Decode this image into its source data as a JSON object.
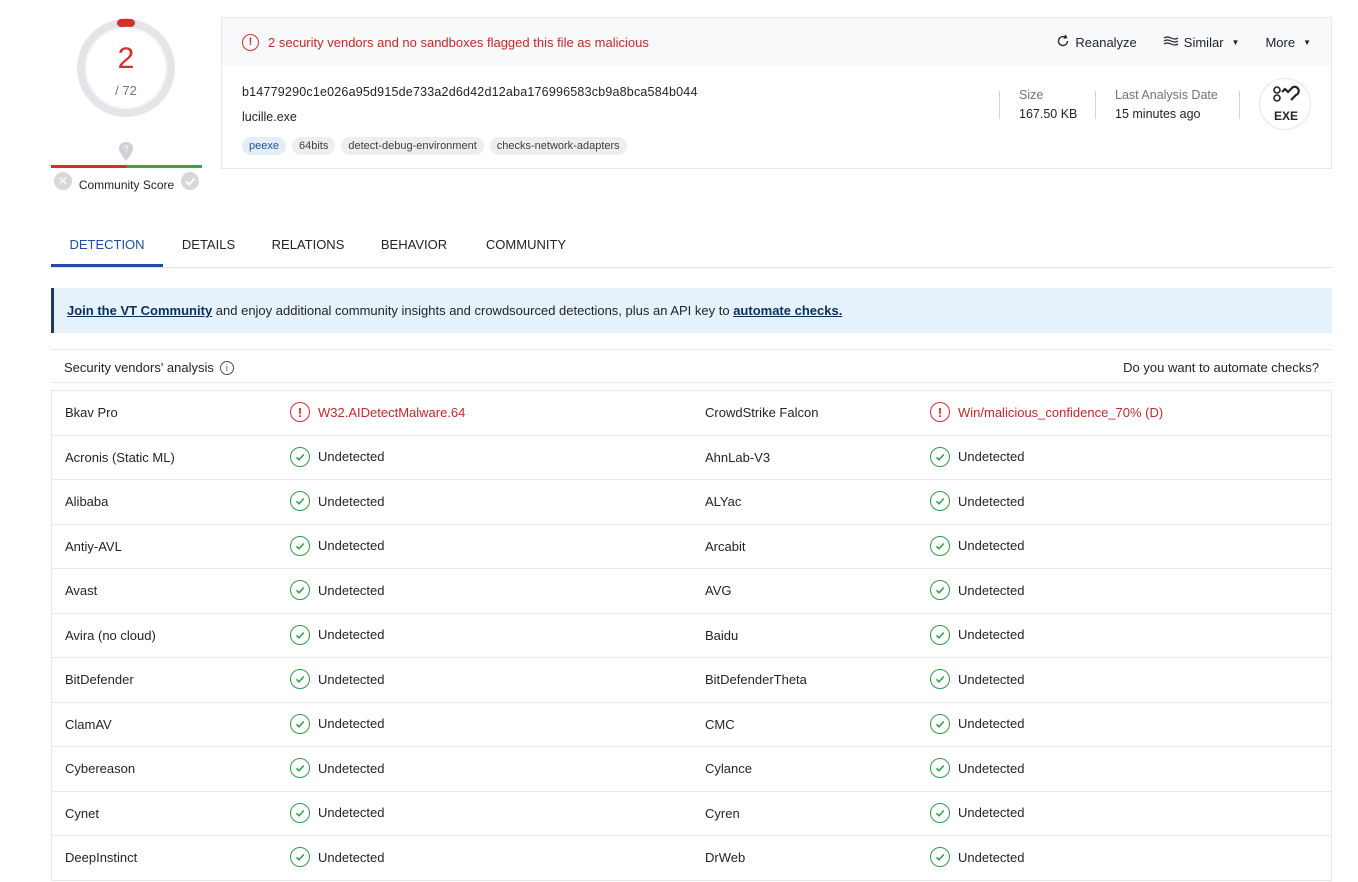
{
  "score": {
    "detected": "2",
    "total": "/ 72",
    "community_label": "Community Score"
  },
  "card": {
    "alert": "2 security vendors and no sandboxes flagged this file as malicious",
    "actions": {
      "reanalyze": "Reanalyze",
      "similar": "Similar",
      "more": "More"
    },
    "hash": "b14779290c1e026a95d915de733a2d6d42d12aba176996583cb9a8bca584b044",
    "filename": "lucille.exe",
    "tags": [
      "peexe",
      "64bits",
      "detect-debug-environment",
      "checks-network-adapters"
    ],
    "size_label": "Size",
    "size_value": "167.50 KB",
    "date_label": "Last Analysis Date",
    "date_value": "15 minutes ago",
    "file_type": "EXE"
  },
  "tabs": [
    "DETECTION",
    "DETAILS",
    "RELATIONS",
    "BEHAVIOR",
    "COMMUNITY"
  ],
  "banner": {
    "link1": "Join the VT Community",
    "middle": " and enjoy additional community insights and crowdsourced detections, plus an API key to ",
    "link2": "automate checks."
  },
  "analysis": {
    "title": "Security vendors' analysis",
    "right": "Do you want to automate checks?",
    "rows": [
      [
        {
          "vendor": "Bkav Pro",
          "result": "W32.AIDetectMalware.64",
          "status": "malicious"
        },
        {
          "vendor": "CrowdStrike Falcon",
          "result": "Win/malicious_confidence_70% (D)",
          "status": "malicious"
        }
      ],
      [
        {
          "vendor": "Acronis (Static ML)",
          "result": "Undetected",
          "status": "ok"
        },
        {
          "vendor": "AhnLab-V3",
          "result": "Undetected",
          "status": "ok"
        }
      ],
      [
        {
          "vendor": "Alibaba",
          "result": "Undetected",
          "status": "ok"
        },
        {
          "vendor": "ALYac",
          "result": "Undetected",
          "status": "ok"
        }
      ],
      [
        {
          "vendor": "Antiy-AVL",
          "result": "Undetected",
          "status": "ok"
        },
        {
          "vendor": "Arcabit",
          "result": "Undetected",
          "status": "ok"
        }
      ],
      [
        {
          "vendor": "Avast",
          "result": "Undetected",
          "status": "ok"
        },
        {
          "vendor": "AVG",
          "result": "Undetected",
          "status": "ok"
        }
      ],
      [
        {
          "vendor": "Avira (no cloud)",
          "result": "Undetected",
          "status": "ok"
        },
        {
          "vendor": "Baidu",
          "result": "Undetected",
          "status": "ok"
        }
      ],
      [
        {
          "vendor": "BitDefender",
          "result": "Undetected",
          "status": "ok"
        },
        {
          "vendor": "BitDefenderTheta",
          "result": "Undetected",
          "status": "ok"
        }
      ],
      [
        {
          "vendor": "ClamAV",
          "result": "Undetected",
          "status": "ok"
        },
        {
          "vendor": "CMC",
          "result": "Undetected",
          "status": "ok"
        }
      ],
      [
        {
          "vendor": "Cybereason",
          "result": "Undetected",
          "status": "ok"
        },
        {
          "vendor": "Cylance",
          "result": "Undetected",
          "status": "ok"
        }
      ],
      [
        {
          "vendor": "Cynet",
          "result": "Undetected",
          "status": "ok"
        },
        {
          "vendor": "Cyren",
          "result": "Undetected",
          "status": "ok"
        }
      ],
      [
        {
          "vendor": "DeepInstinct",
          "result": "Undetected",
          "status": "ok"
        },
        {
          "vendor": "DrWeb",
          "result": "Undetected",
          "status": "ok"
        }
      ]
    ]
  },
  "colors": {
    "malicious": "#d32f2f",
    "ok": "#2e9e44",
    "accent": "#1d4ea6"
  }
}
